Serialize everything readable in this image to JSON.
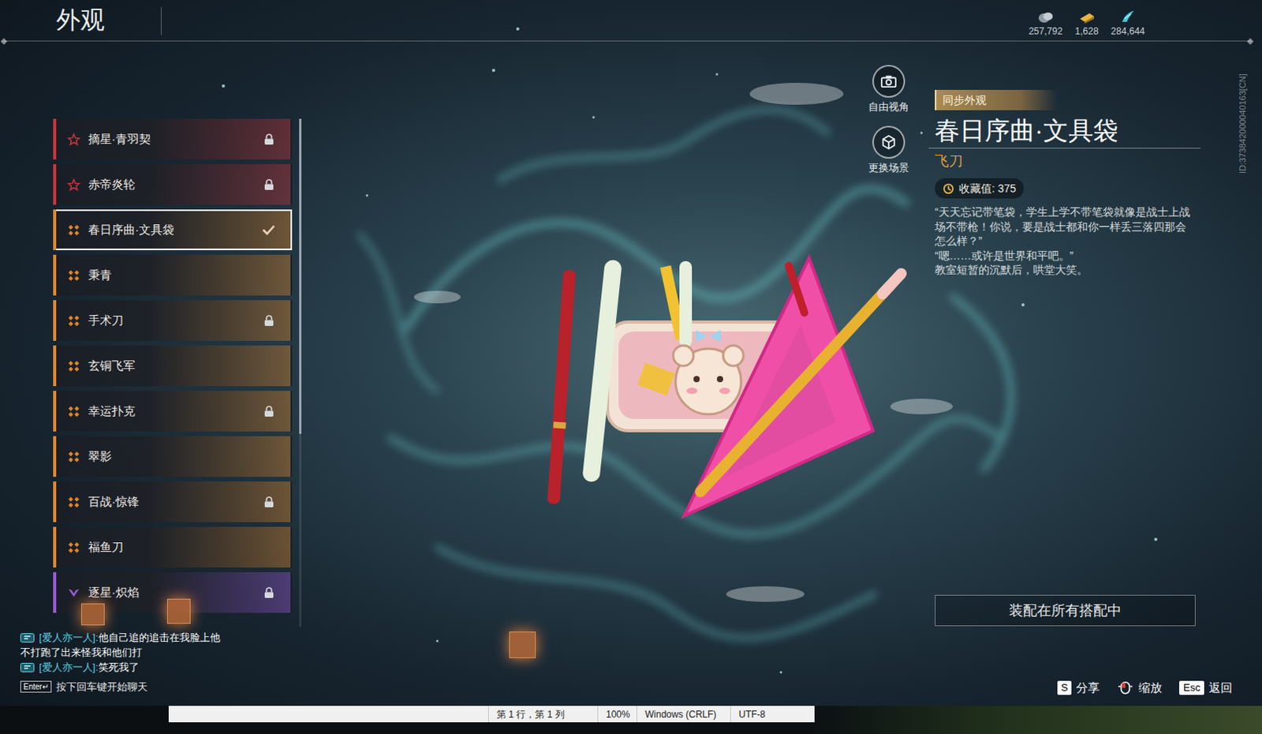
{
  "header": {
    "title": "外观"
  },
  "currencies": [
    {
      "value": "257,792"
    },
    {
      "value": "1,628"
    },
    {
      "value": "284,644"
    }
  ],
  "player_id": "ID:373842000040163[CN]",
  "items": [
    {
      "name": "摘星·青羽契",
      "kind": "star",
      "color": "#c8353a",
      "locked": true,
      "selected": false
    },
    {
      "name": "赤帝炎轮",
      "kind": "star",
      "color": "#c8353a",
      "locked": true,
      "selected": false
    },
    {
      "name": "春日序曲·文具袋",
      "kind": "cross",
      "color": "#e0872d",
      "locked": false,
      "selected": true
    },
    {
      "name": "秉青",
      "kind": "cross",
      "color": "#e0872d",
      "locked": false,
      "selected": false
    },
    {
      "name": "手术刀",
      "kind": "cross",
      "color": "#e0872d",
      "locked": true,
      "selected": false
    },
    {
      "name": "玄铜飞军",
      "kind": "cross",
      "color": "#e0872d",
      "locked": false,
      "selected": false
    },
    {
      "name": "幸运扑克",
      "kind": "cross",
      "color": "#e0872d",
      "locked": true,
      "selected": false
    },
    {
      "name": "翠影",
      "kind": "cross",
      "color": "#e0872d",
      "locked": false,
      "selected": false
    },
    {
      "name": "百战·惊锋",
      "kind": "cross",
      "color": "#e0872d",
      "locked": true,
      "selected": false
    },
    {
      "name": "福鱼刀",
      "kind": "cross",
      "color": "#e0872d",
      "locked": false,
      "selected": false
    },
    {
      "name": "逐星·炽焰",
      "kind": "crown",
      "color": "#9b59d6",
      "locked": true,
      "selected": false
    }
  ],
  "scrollbar": {
    "level": 0.62
  },
  "view_buttons": [
    {
      "label": "自由视角"
    },
    {
      "label": "更换场景"
    }
  ],
  "detail": {
    "tag": "同步外观",
    "title": "春日序曲·文具袋",
    "category": "飞刀",
    "collection": "收藏值: 375",
    "description": [
      "“天天忘记带笔袋，学生上学不带笔袋就像是战士上战场不带枪！你说，要是战士都和你一样丢三落四那会怎么样？”",
      "“嗯……或许是世界和平吧。”",
      "教室短暂的沉默后，哄堂大笑。"
    ],
    "equip_button": "装配在所有搭配中"
  },
  "key_hints": [
    {
      "kind": "key",
      "key": "S",
      "label": "分享"
    },
    {
      "kind": "mouse",
      "label": "缩放"
    },
    {
      "kind": "key",
      "key": "Esc",
      "label": "返回"
    }
  ],
  "chat": {
    "messages": [
      {
        "sender": "[爱人亦一人]:",
        "lines": [
          "他自己追的追击在我脸上他",
          "不打跑了出来怪我和他们打"
        ]
      },
      {
        "sender": "[爱人亦一人]:",
        "lines": [
          "笑死我了"
        ]
      }
    ],
    "hint_key": "Enter↵",
    "hint": "按下回车键开始聊天"
  },
  "editor_status": [
    "第 1 行，第 1 列",
    "100%",
    "Windows (CRLF)",
    "UTF-8"
  ]
}
